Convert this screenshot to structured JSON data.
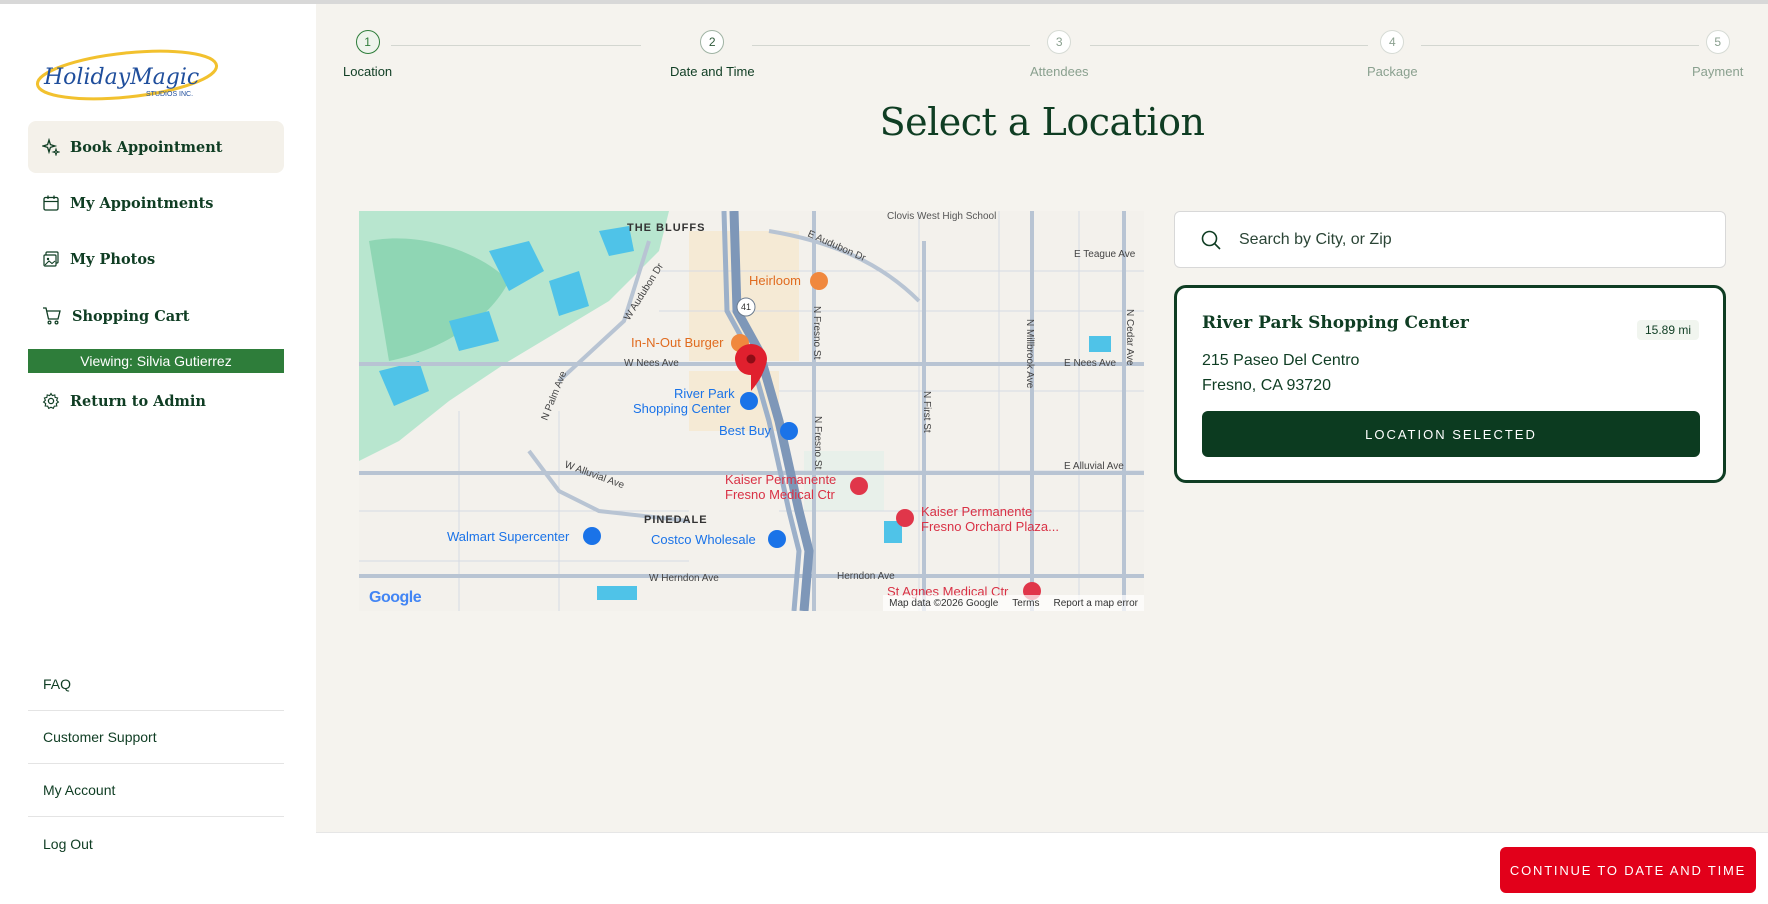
{
  "brand": {
    "logo_main": "HolidayMagic",
    "logo_sub": "STUDIOS INC.",
    "primary_color": "#0f3d23",
    "accent_color": "#e2001a"
  },
  "sidebar": {
    "items": [
      {
        "label": "Book Appointment",
        "icon": "sparkle-icon"
      },
      {
        "label": "My Appointments",
        "icon": "calendar-icon"
      },
      {
        "label": "My Photos",
        "icon": "photos-icon"
      },
      {
        "label": "Shopping Cart",
        "icon": "cart-icon"
      }
    ],
    "viewing": "Viewing: Silvia Gutierrez",
    "return_admin": "Return to Admin",
    "footer": [
      "FAQ",
      "Customer Support",
      "My Account",
      "Log Out"
    ]
  },
  "stepper": {
    "steps": [
      {
        "num": "1",
        "label": "Location"
      },
      {
        "num": "2",
        "label": "Date and Time"
      },
      {
        "num": "3",
        "label": "Attendees"
      },
      {
        "num": "4",
        "label": "Package"
      },
      {
        "num": "5",
        "label": "Payment"
      }
    ]
  },
  "main": {
    "title": "Select a Location",
    "search": {
      "placeholder": "Search by City, or Zip",
      "value": ""
    },
    "location": {
      "name": "River Park Shopping Center",
      "distance": "15.89 mi",
      "address_line1": "215 Paseo Del Centro",
      "address_line2": "Fresno, CA 93720",
      "button": "LOCATION SELECTED"
    }
  },
  "map": {
    "labels": {
      "bluffs": "THE BLUFFS",
      "pinedale": "PINEDALE",
      "heirloom": "Heirloom",
      "innout": "In-N-Out Burger",
      "riverpark1": "River Park",
      "riverpark2": "Shopping Center",
      "bestbuy": "Best Buy",
      "kaiser1a": "Kaiser Permanente",
      "kaiser1b": "Fresno Medical Ctr",
      "kaiser2a": "Kaiser Permanente",
      "kaiser2b": "Fresno Orchard Plaza...",
      "walmart": "Walmart Supercenter",
      "costco": "Costco Wholesale",
      "stagnes": "St Agnes Medical Ctr",
      "w_nees": "W Nees Ave",
      "e_nees": "E Nees Ave",
      "w_herndon": "W Herndon Ave",
      "herndon": "Herndon Ave",
      "e_alluvial": "E Alluvial Ave",
      "w_alluvial": "W Alluvial Ave",
      "e_teague": "E Teague Ave",
      "w_audubon": "W Audubon Dr",
      "e_audubon": "E Audubon Dr",
      "n_palm": "N Palm Ave",
      "n_fresno1": "N Fresno St",
      "n_fresno2": "N Fresno St",
      "n_first": "N First St",
      "n_millbrook": "N Millbrook Ave",
      "n_cedar": "N Cedar Ave",
      "clovis": "Clovis West High School",
      "hwy41": "41"
    },
    "google": "Google",
    "map_data": "Map data ©2026 Google",
    "terms": "Terms",
    "report": "Report a map error"
  },
  "bottom": {
    "continue": "CONTINUE TO DATE AND TIME"
  }
}
